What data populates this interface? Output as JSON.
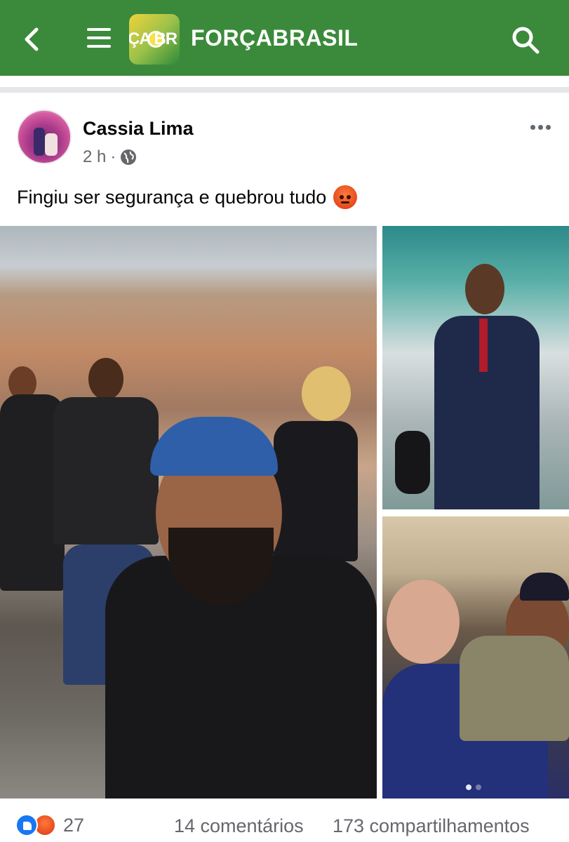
{
  "header": {
    "logo_text": "ÇA BR",
    "title": "FORÇABRASIL"
  },
  "post": {
    "author": "Cassia Lima",
    "time": "2 h",
    "separator": "·",
    "caption": "Fingiu ser segurança e quebrou tudo",
    "photos": [
      {
        "name": "photo-main"
      },
      {
        "name": "photo-top-right"
      },
      {
        "name": "photo-bottom-right"
      }
    ],
    "carousel_pages": 2,
    "carousel_active": 1
  },
  "footer": {
    "reaction_count": "27",
    "comments": "14 comentários",
    "shares": "173 compartilhamentos"
  },
  "colors": {
    "topbar": "#3b8a3b",
    "meta_text": "#65676b",
    "like_blue": "#1877f2",
    "angry_orange": "#e2421a"
  },
  "icons": [
    "back-arrow-icon",
    "hamburger-menu-icon",
    "search-icon",
    "globe-icon",
    "more-options-icon",
    "like-reaction-icon",
    "angry-reaction-icon",
    "angry-emoji-icon"
  ]
}
